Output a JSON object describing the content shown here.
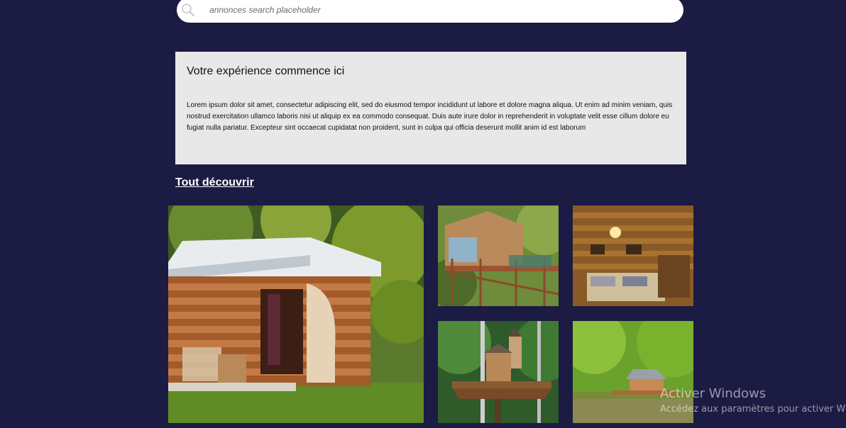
{
  "search": {
    "placeholder": "annonces search placeholder"
  },
  "intro": {
    "title": "Votre expérience commence ici",
    "body": "Lorem ipsum dolor sit amet, consectetur adipiscing elit, sed do eiusmod tempor incididunt ut labore et dolore magna aliqua. Ut enim ad minim veniam, quis nostrud exercitation ullamco laboris nisi ut aliquip ex ea commodo consequat. Duis aute irure dolor in reprehenderit in voluptate velit esse cillum dolore eu fugiat nulla pariatur. Excepteur sint occaecat cupidatat non proident, sunt in culpa qui officia deserunt mollit anim id est laborum"
  },
  "discover": {
    "label": "Tout découvrir"
  },
  "gallery": {
    "photos": [
      {
        "name": "log-cabin-photo"
      },
      {
        "name": "treehouse-deck-photo"
      },
      {
        "name": "cabin-bedroom-photo"
      },
      {
        "name": "forest-treehouse-tower-photo"
      },
      {
        "name": "lake-cabin-photo"
      }
    ]
  },
  "watermark": {
    "title": "Activer Windows",
    "subtitle": "Accédez aux paramètres pour activer W"
  },
  "colors": {
    "background": "#1b1b44",
    "panel": "#e8e8e8",
    "link": "#ffffff"
  }
}
